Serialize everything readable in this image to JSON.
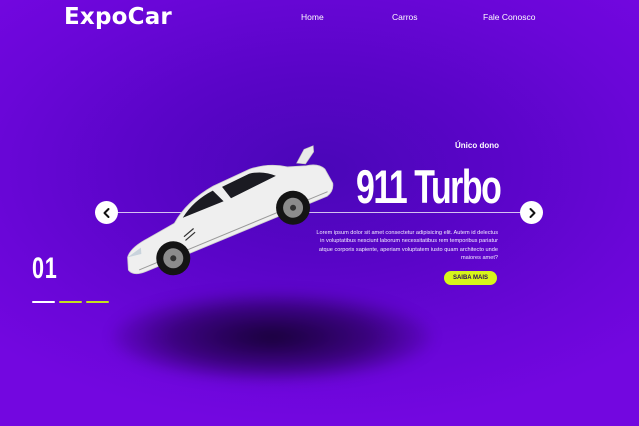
{
  "header": {
    "logo": "ExpoCar",
    "nav": [
      {
        "label": "Home"
      },
      {
        "label": "Carros"
      },
      {
        "label": "Fale Conosco"
      }
    ]
  },
  "hero": {
    "owner_label": "Único dono",
    "model": "911 Turbo",
    "description": "Lorem ipsum dolor sit amet consectetur adipisicing elit. Autem id delectus in voluptatibus nesciunt laborum necessitatibus rem temporibus pariatur atque corporis sapiente, aperiam voluptatem iusto quam architecto unde maiores amet?",
    "cta_label": "SAIBA MAIS",
    "cta_color": "#d7f51a"
  },
  "slider": {
    "current": "01",
    "prev_icon": "chevron-left-icon",
    "next_icon": "chevron-right-icon",
    "indicator_colors": [
      "#ffffff",
      "#c5e01e",
      "#c5e01e"
    ]
  },
  "theme": {
    "background": "#5a05c8",
    "accent": "#d7f51a"
  }
}
